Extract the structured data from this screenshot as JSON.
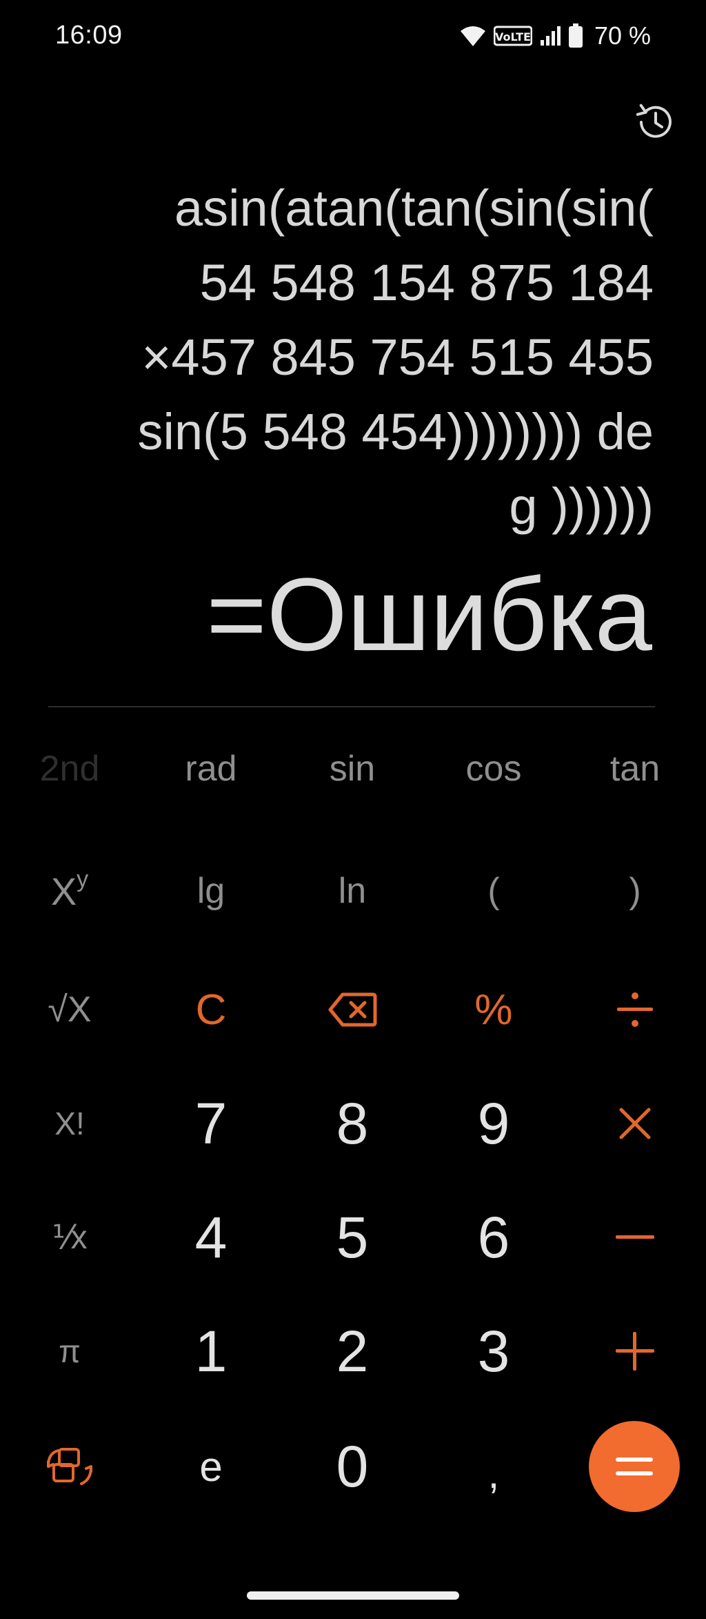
{
  "status": {
    "time": "16:09",
    "battery": "70 %",
    "volte": "VoLTE"
  },
  "expression_lines": [
    "asin(atan(tan(sin(sin(",
    "54 548 154 875 184",
    "×457 845 754 515 455",
    "sin(5 548 454)))))))) de",
    "g ))))))"
  ],
  "result": "=Ошибка",
  "keys": {
    "second": "2nd",
    "rad": "rad",
    "sin": "sin",
    "cos": "cos",
    "tan": "tan",
    "power_base": "X",
    "power_exp": "y",
    "lg": "lg",
    "ln": "ln",
    "paren_open": "(",
    "paren_close": ")",
    "sqrt": "√X",
    "clear": "C",
    "percent": "%",
    "factorial": "X!",
    "seven": "7",
    "eight": "8",
    "nine": "9",
    "reciprocal": "⅟x",
    "four": "4",
    "five": "5",
    "six": "6",
    "pi": "π",
    "one": "1",
    "two": "2",
    "three": "3",
    "e": "e",
    "zero": "0",
    "comma": ","
  },
  "colors": {
    "accent": "#e2672c",
    "equals_bg": "#f26b2f",
    "background": "#000000"
  }
}
